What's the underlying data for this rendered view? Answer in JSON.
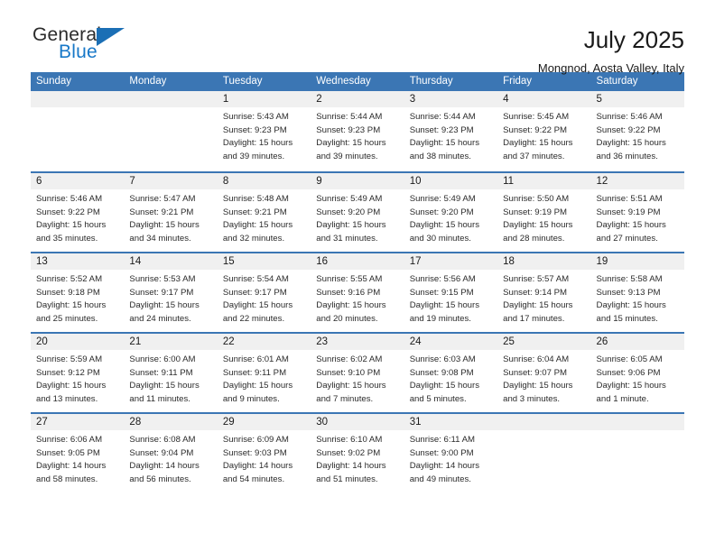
{
  "logo": {
    "word1": "General",
    "word2": "Blue",
    "triangle_color": "#1b6fb5",
    "blue_color": "#1878c8"
  },
  "header": {
    "title": "July 2025",
    "subtitle": "Mongnod, Aosta Valley, Italy"
  },
  "theme": {
    "header_blue": "#3b76b4",
    "daynum_band": "#f0f0f0",
    "text": "#2b2b2b"
  },
  "calendar": {
    "weekday_headers": [
      "Sunday",
      "Monday",
      "Tuesday",
      "Wednesday",
      "Thursday",
      "Friday",
      "Saturday"
    ],
    "weeks": [
      [
        {
          "day": "",
          "empty": true,
          "sunrise": "",
          "sunset": "",
          "daylight1": "",
          "daylight2": ""
        },
        {
          "day": "",
          "empty": true,
          "sunrise": "",
          "sunset": "",
          "daylight1": "",
          "daylight2": ""
        },
        {
          "day": "1",
          "empty": false,
          "sunrise": "Sunrise: 5:43 AM",
          "sunset": "Sunset: 9:23 PM",
          "daylight1": "Daylight: 15 hours",
          "daylight2": "and 39 minutes."
        },
        {
          "day": "2",
          "empty": false,
          "sunrise": "Sunrise: 5:44 AM",
          "sunset": "Sunset: 9:23 PM",
          "daylight1": "Daylight: 15 hours",
          "daylight2": "and 39 minutes."
        },
        {
          "day": "3",
          "empty": false,
          "sunrise": "Sunrise: 5:44 AM",
          "sunset": "Sunset: 9:23 PM",
          "daylight1": "Daylight: 15 hours",
          "daylight2": "and 38 minutes."
        },
        {
          "day": "4",
          "empty": false,
          "sunrise": "Sunrise: 5:45 AM",
          "sunset": "Sunset: 9:22 PM",
          "daylight1": "Daylight: 15 hours",
          "daylight2": "and 37 minutes."
        },
        {
          "day": "5",
          "empty": false,
          "sunrise": "Sunrise: 5:46 AM",
          "sunset": "Sunset: 9:22 PM",
          "daylight1": "Daylight: 15 hours",
          "daylight2": "and 36 minutes."
        }
      ],
      [
        {
          "day": "6",
          "empty": false,
          "sunrise": "Sunrise: 5:46 AM",
          "sunset": "Sunset: 9:22 PM",
          "daylight1": "Daylight: 15 hours",
          "daylight2": "and 35 minutes."
        },
        {
          "day": "7",
          "empty": false,
          "sunrise": "Sunrise: 5:47 AM",
          "sunset": "Sunset: 9:21 PM",
          "daylight1": "Daylight: 15 hours",
          "daylight2": "and 34 minutes."
        },
        {
          "day": "8",
          "empty": false,
          "sunrise": "Sunrise: 5:48 AM",
          "sunset": "Sunset: 9:21 PM",
          "daylight1": "Daylight: 15 hours",
          "daylight2": "and 32 minutes."
        },
        {
          "day": "9",
          "empty": false,
          "sunrise": "Sunrise: 5:49 AM",
          "sunset": "Sunset: 9:20 PM",
          "daylight1": "Daylight: 15 hours",
          "daylight2": "and 31 minutes."
        },
        {
          "day": "10",
          "empty": false,
          "sunrise": "Sunrise: 5:49 AM",
          "sunset": "Sunset: 9:20 PM",
          "daylight1": "Daylight: 15 hours",
          "daylight2": "and 30 minutes."
        },
        {
          "day": "11",
          "empty": false,
          "sunrise": "Sunrise: 5:50 AM",
          "sunset": "Sunset: 9:19 PM",
          "daylight1": "Daylight: 15 hours",
          "daylight2": "and 28 minutes."
        },
        {
          "day": "12",
          "empty": false,
          "sunrise": "Sunrise: 5:51 AM",
          "sunset": "Sunset: 9:19 PM",
          "daylight1": "Daylight: 15 hours",
          "daylight2": "and 27 minutes."
        }
      ],
      [
        {
          "day": "13",
          "empty": false,
          "sunrise": "Sunrise: 5:52 AM",
          "sunset": "Sunset: 9:18 PM",
          "daylight1": "Daylight: 15 hours",
          "daylight2": "and 25 minutes."
        },
        {
          "day": "14",
          "empty": false,
          "sunrise": "Sunrise: 5:53 AM",
          "sunset": "Sunset: 9:17 PM",
          "daylight1": "Daylight: 15 hours",
          "daylight2": "and 24 minutes."
        },
        {
          "day": "15",
          "empty": false,
          "sunrise": "Sunrise: 5:54 AM",
          "sunset": "Sunset: 9:17 PM",
          "daylight1": "Daylight: 15 hours",
          "daylight2": "and 22 minutes."
        },
        {
          "day": "16",
          "empty": false,
          "sunrise": "Sunrise: 5:55 AM",
          "sunset": "Sunset: 9:16 PM",
          "daylight1": "Daylight: 15 hours",
          "daylight2": "and 20 minutes."
        },
        {
          "day": "17",
          "empty": false,
          "sunrise": "Sunrise: 5:56 AM",
          "sunset": "Sunset: 9:15 PM",
          "daylight1": "Daylight: 15 hours",
          "daylight2": "and 19 minutes."
        },
        {
          "day": "18",
          "empty": false,
          "sunrise": "Sunrise: 5:57 AM",
          "sunset": "Sunset: 9:14 PM",
          "daylight1": "Daylight: 15 hours",
          "daylight2": "and 17 minutes."
        },
        {
          "day": "19",
          "empty": false,
          "sunrise": "Sunrise: 5:58 AM",
          "sunset": "Sunset: 9:13 PM",
          "daylight1": "Daylight: 15 hours",
          "daylight2": "and 15 minutes."
        }
      ],
      [
        {
          "day": "20",
          "empty": false,
          "sunrise": "Sunrise: 5:59 AM",
          "sunset": "Sunset: 9:12 PM",
          "daylight1": "Daylight: 15 hours",
          "daylight2": "and 13 minutes."
        },
        {
          "day": "21",
          "empty": false,
          "sunrise": "Sunrise: 6:00 AM",
          "sunset": "Sunset: 9:11 PM",
          "daylight1": "Daylight: 15 hours",
          "daylight2": "and 11 minutes."
        },
        {
          "day": "22",
          "empty": false,
          "sunrise": "Sunrise: 6:01 AM",
          "sunset": "Sunset: 9:11 PM",
          "daylight1": "Daylight: 15 hours",
          "daylight2": "and 9 minutes."
        },
        {
          "day": "23",
          "empty": false,
          "sunrise": "Sunrise: 6:02 AM",
          "sunset": "Sunset: 9:10 PM",
          "daylight1": "Daylight: 15 hours",
          "daylight2": "and 7 minutes."
        },
        {
          "day": "24",
          "empty": false,
          "sunrise": "Sunrise: 6:03 AM",
          "sunset": "Sunset: 9:08 PM",
          "daylight1": "Daylight: 15 hours",
          "daylight2": "and 5 minutes."
        },
        {
          "day": "25",
          "empty": false,
          "sunrise": "Sunrise: 6:04 AM",
          "sunset": "Sunset: 9:07 PM",
          "daylight1": "Daylight: 15 hours",
          "daylight2": "and 3 minutes."
        },
        {
          "day": "26",
          "empty": false,
          "sunrise": "Sunrise: 6:05 AM",
          "sunset": "Sunset: 9:06 PM",
          "daylight1": "Daylight: 15 hours",
          "daylight2": "and 1 minute."
        }
      ],
      [
        {
          "day": "27",
          "empty": false,
          "sunrise": "Sunrise: 6:06 AM",
          "sunset": "Sunset: 9:05 PM",
          "daylight1": "Daylight: 14 hours",
          "daylight2": "and 58 minutes."
        },
        {
          "day": "28",
          "empty": false,
          "sunrise": "Sunrise: 6:08 AM",
          "sunset": "Sunset: 9:04 PM",
          "daylight1": "Daylight: 14 hours",
          "daylight2": "and 56 minutes."
        },
        {
          "day": "29",
          "empty": false,
          "sunrise": "Sunrise: 6:09 AM",
          "sunset": "Sunset: 9:03 PM",
          "daylight1": "Daylight: 14 hours",
          "daylight2": "and 54 minutes."
        },
        {
          "day": "30",
          "empty": false,
          "sunrise": "Sunrise: 6:10 AM",
          "sunset": "Sunset: 9:02 PM",
          "daylight1": "Daylight: 14 hours",
          "daylight2": "and 51 minutes."
        },
        {
          "day": "31",
          "empty": false,
          "sunrise": "Sunrise: 6:11 AM",
          "sunset": "Sunset: 9:00 PM",
          "daylight1": "Daylight: 14 hours",
          "daylight2": "and 49 minutes."
        },
        {
          "day": "",
          "empty": true,
          "sunrise": "",
          "sunset": "",
          "daylight1": "",
          "daylight2": ""
        },
        {
          "day": "",
          "empty": true,
          "sunrise": "",
          "sunset": "",
          "daylight1": "",
          "daylight2": ""
        }
      ]
    ]
  }
}
